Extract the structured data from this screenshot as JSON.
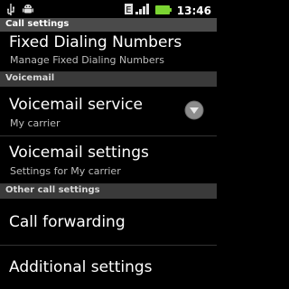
{
  "statusbar": {
    "time": "13:46",
    "icons": [
      "usb-icon",
      "android-debug-icon",
      "signal-icon",
      "battery-icon"
    ],
    "signal_glyph": "E"
  },
  "titlebar": {
    "title": "Call settings"
  },
  "rows": [
    {
      "title": "Fixed Dialing Numbers",
      "subtitle": "Manage Fixed Dialing Numbers"
    },
    {
      "title": "Voicemail service",
      "subtitle": "My carrier"
    },
    {
      "title": "Voicemail settings",
      "subtitle": "Settings for My carrier"
    },
    {
      "title": "Call forwarding"
    },
    {
      "title": "Additional settings"
    }
  ],
  "headers": [
    "Voicemail",
    "Other call settings"
  ],
  "colors": {
    "battery": "#7bd432",
    "titlebar": "#4a4a4a",
    "section_header": "#3a3a3a"
  }
}
